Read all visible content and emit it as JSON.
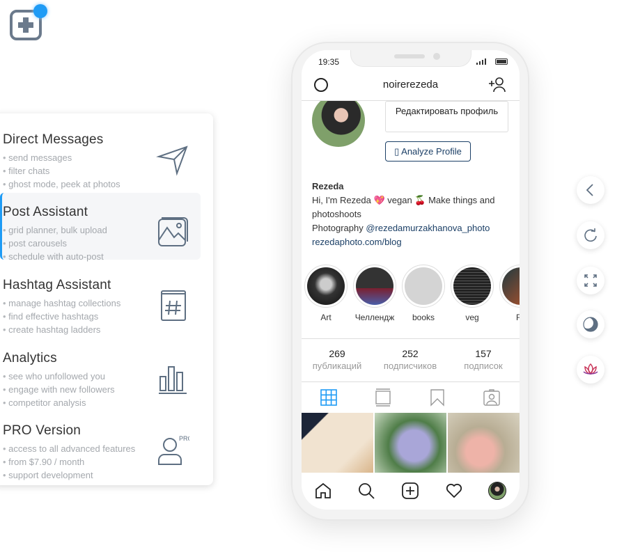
{
  "app": {
    "logo_icon": "plus-square-icon",
    "accent": "#1e9bf5"
  },
  "menu": [
    {
      "title": "Direct Messages",
      "bullets": [
        "send messages",
        "filter chats",
        "ghost mode, peek at photos"
      ],
      "icon": "paper-plane-icon"
    },
    {
      "title": "Post Assistant",
      "bullets": [
        "grid planner, bulk upload",
        "post carousels",
        "schedule with auto-post"
      ],
      "icon": "images-icon",
      "active": true
    },
    {
      "title": "Hashtag Assistant",
      "bullets": [
        "manage hashtag collections",
        "find effective hashtags",
        "create hashtag ladders"
      ],
      "icon": "hashtag-book-icon"
    },
    {
      "title": "Analytics",
      "bullets": [
        "see who unfollowed you",
        "engage with new followers",
        "competitor analysis"
      ],
      "icon": "bar-chart-icon"
    },
    {
      "title": "PRO Version",
      "bullets": [
        "access to all advanced features",
        "from $7.90 / month",
        "support development"
      ],
      "icon": "pro-user-icon",
      "badge": "PRO"
    }
  ],
  "phone": {
    "time": "19:35",
    "username": "noirerezeda",
    "edit_profile": "Редактировать профиль",
    "analyze_profile": "▯ Analyze Profile",
    "bio": {
      "name": "Rezeda",
      "line1": "Hi, I'm Rezeda 💖 vegan 🍒 Make things and photoshoots",
      "line2_prefix": "Photography ",
      "mention": "@rezedamurzakhanova_photo",
      "website": "rezedaphoto.com/blog"
    },
    "highlights": [
      "Art",
      "Челлендж",
      "books",
      "veg",
      "Fo"
    ],
    "stats": [
      {
        "value": "269",
        "label": "публикаций"
      },
      {
        "value": "252",
        "label": "подписчиков"
      },
      {
        "value": "157",
        "label": "подписок"
      }
    ]
  },
  "side_buttons": [
    "back-icon",
    "reload-icon",
    "fullscreen-icon",
    "dark-mode-icon",
    "lotus-icon"
  ]
}
